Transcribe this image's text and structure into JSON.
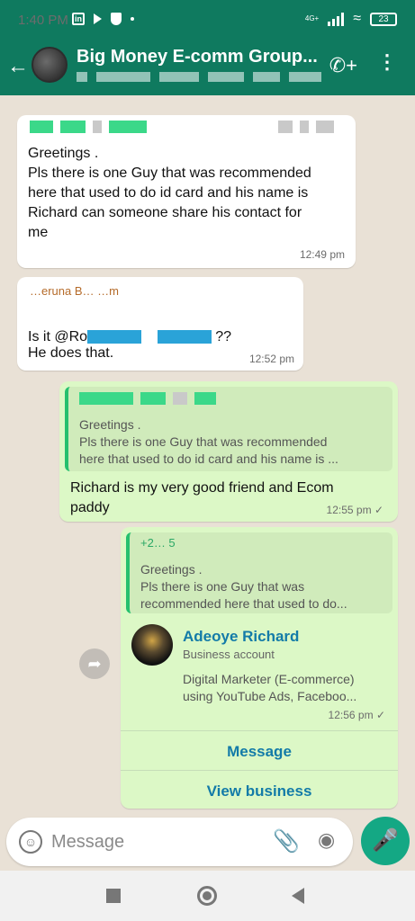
{
  "status_bar": {
    "time": "1:40 PM",
    "network": "4G+",
    "battery": "23"
  },
  "header": {
    "back_icon": "arrow-left-icon",
    "title": "Big Money E-comm Group..."
  },
  "messages": [
    {
      "id": "m1",
      "direction": "incoming",
      "text": "Greetings .\nPls there is one Guy that was recommended here that used to do id card and his name is Richard can someone share his contact for me",
      "time": "12:49 pm"
    },
    {
      "id": "m2",
      "direction": "incoming",
      "sender_partial": "…eruna B… …m",
      "text_before": "Is it @Ro",
      "text_after": "??",
      "text_line2": "He does that.",
      "time": "12:52 pm"
    },
    {
      "id": "m3",
      "direction": "outgoing",
      "quote_line1": "Greetings .",
      "quote_line2": "Pls there is one Guy that was recommended",
      "quote_line3": "here that used to do id card and his name is ...",
      "text": "Richard is my very good friend and Ecom paddy",
      "time": "12:55 pm"
    },
    {
      "id": "m4",
      "direction": "outgoing",
      "quote_name_partial": "+2…                    5",
      "quote_line1": "Greetings .",
      "quote_line2": "Pls there is one Guy that was",
      "quote_line3": "recommended here that used to do...",
      "contact": {
        "name": "Adeoye Richard",
        "type": "Business account",
        "description": "Digital Marketer (E-commerce)\nusing YouTube Ads, Faceboo..."
      },
      "time": "12:56 pm",
      "buttons": {
        "message": "Message",
        "view_business": "View business"
      }
    }
  ],
  "composer": {
    "placeholder": "Message"
  },
  "colors": {
    "header": "#0f7a5f",
    "outgoing_bubble": "#dcf8c6",
    "link_blue": "#137ba8",
    "mic_green": "#14a884"
  }
}
